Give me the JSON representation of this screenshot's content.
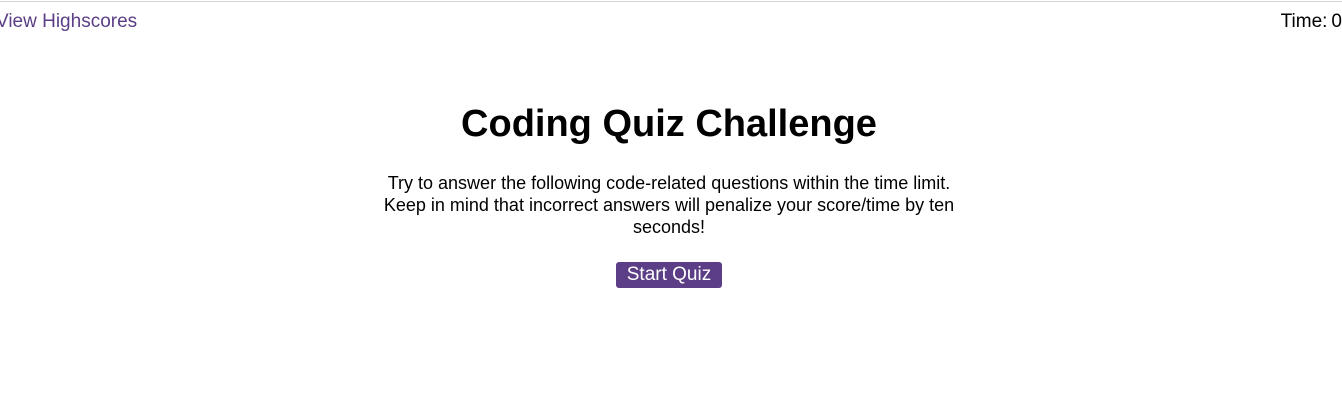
{
  "header": {
    "highscores_link": "View Highscores",
    "timer_label": "Time:",
    "timer_value": "0"
  },
  "main": {
    "title": "Coding Quiz Challenge",
    "description": "Try to answer the following code-related questions within the time limit. Keep in mind that incorrect answers will penalize your score/time by ten seconds!",
    "start_button": "Start Quiz"
  },
  "colors": {
    "accent": "#5b3e85",
    "background": "#ffffff",
    "text": "#000000"
  }
}
